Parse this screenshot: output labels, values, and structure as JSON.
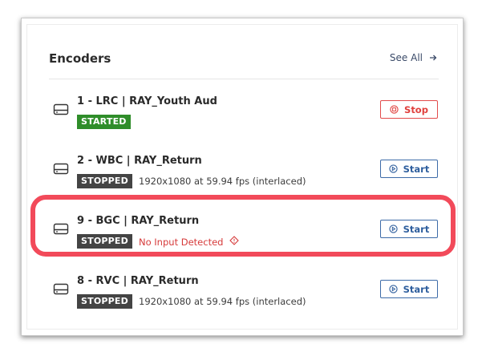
{
  "panel": {
    "title": "Encoders",
    "see_all_label": "See All"
  },
  "encoders": [
    {
      "name": "1 - LRC | RAY_Youth Aud",
      "status": "STARTED",
      "info": "",
      "action": "Stop"
    },
    {
      "name": "2 - WBC | RAY_Return",
      "status": "STOPPED",
      "info": "1920x1080 at 59.94 fps (interlaced)",
      "action": "Start"
    },
    {
      "name": "9 - BGC | RAY_Return",
      "status": "STOPPED",
      "info": "No Input Detected",
      "action": "Start"
    },
    {
      "name": "8 - RVC | RAY_Return",
      "status": "STOPPED",
      "info": "1920x1080 at 59.94 fps (interlaced)",
      "action": "Start"
    }
  ],
  "colors": {
    "started_badge": "#2f8d2a",
    "stopped_badge": "#444444",
    "stop_button": "#e0403d",
    "start_button": "#2f5f9e",
    "error_text": "#d63a3a",
    "highlight": "#f24a5a"
  },
  "icons": {
    "encoder": "encoder-device-icon",
    "see_all": "arrow-right-icon",
    "stop": "stop-circle-icon",
    "start": "play-circle-icon",
    "warning": "warning-diamond-icon"
  }
}
